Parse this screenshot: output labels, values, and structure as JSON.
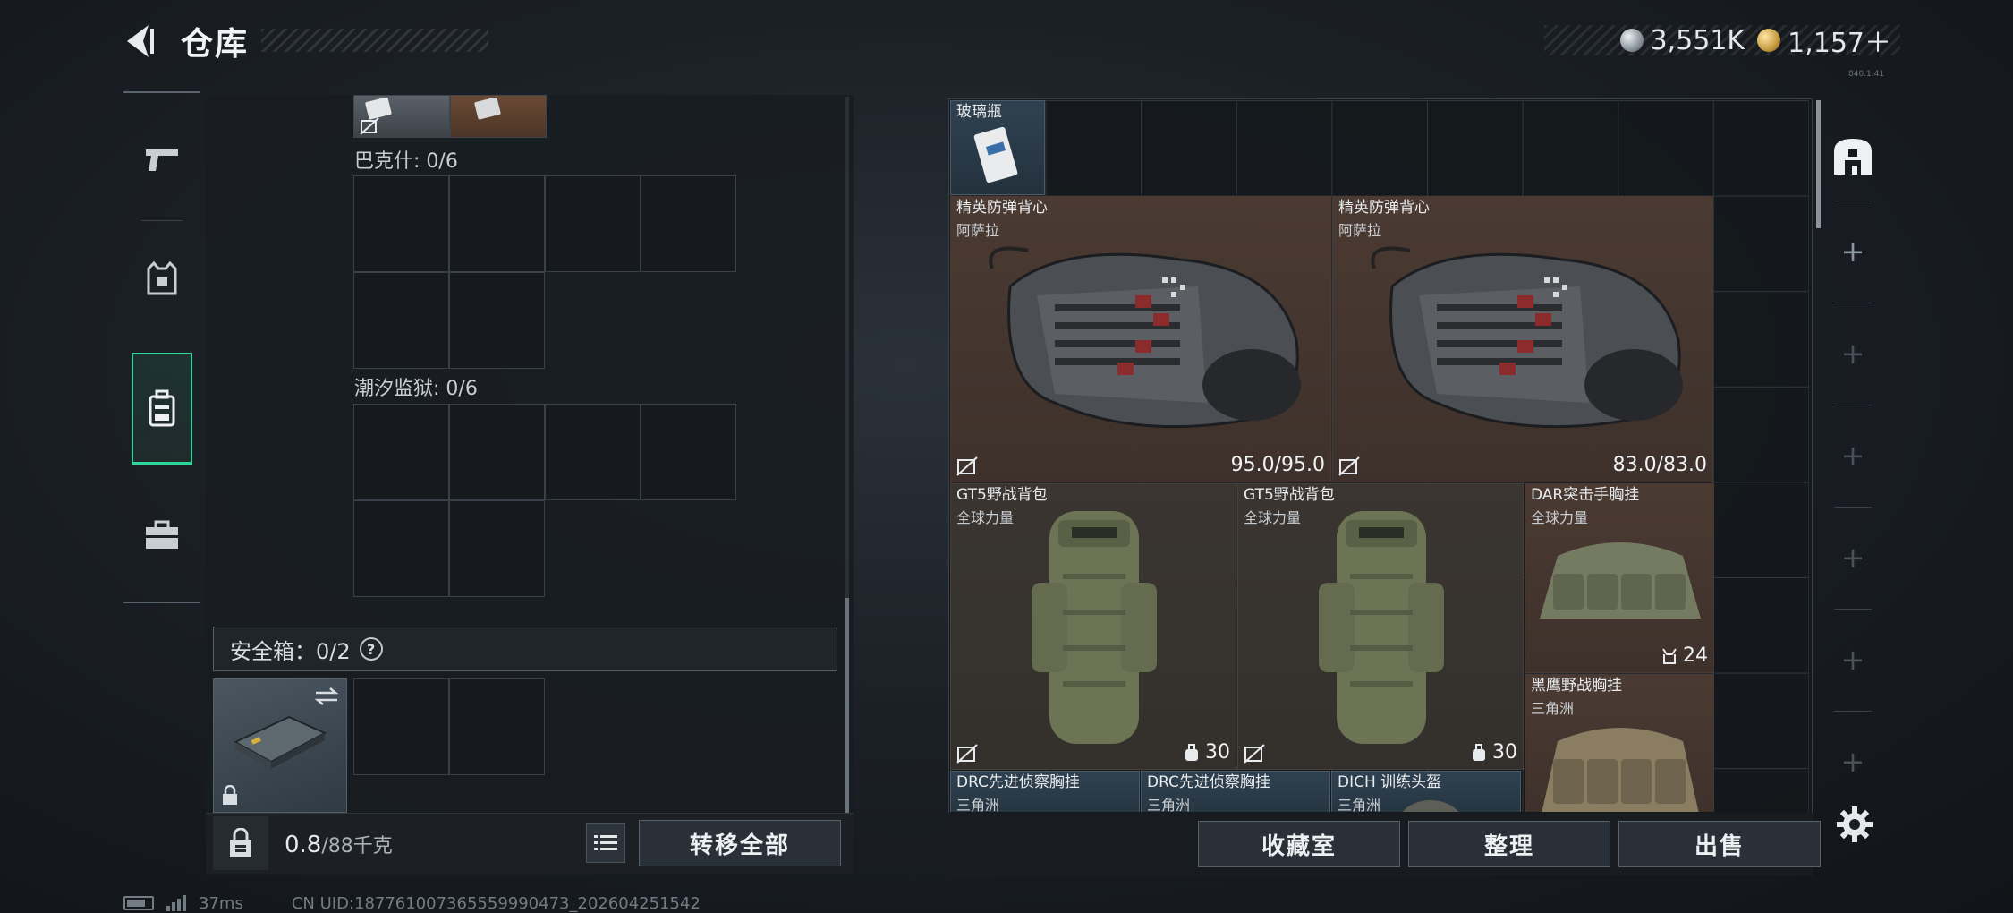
{
  "header": {
    "title": "仓库",
    "currency": [
      {
        "icon": "silver-coin-icon",
        "value": "3,551K"
      },
      {
        "icon": "gold-coin-icon",
        "value": "1,157＋"
      }
    ],
    "version": "840.1.41"
  },
  "nav": {
    "items": [
      {
        "icon": "pistol-icon"
      },
      {
        "icon": "armor-vest-icon"
      },
      {
        "icon": "backpack-icon",
        "active": true
      },
      {
        "icon": "briefcase-icon"
      }
    ]
  },
  "backpack": {
    "sections": [
      {
        "label": "巴克什: 0/6"
      },
      {
        "label": "潮汐监狱: 0/6"
      }
    ],
    "safebox": {
      "label": "安全箱：0/2",
      "help": "?"
    },
    "weight": {
      "current": "0.8",
      "max": "/88千克"
    },
    "transfer_all": "转移全部"
  },
  "stash": {
    "items": [
      {
        "name": "玻璃瓶",
        "brand": ""
      },
      {
        "name": "精英防弹背心",
        "brand": "阿萨拉",
        "stat": "95.0/95.0"
      },
      {
        "name": "精英防弹背心",
        "brand": "阿萨拉",
        "stat": "83.0/83.0"
      },
      {
        "name": "GT5野战背包",
        "brand": "全球力量",
        "stat": "30"
      },
      {
        "name": "GT5野战背包",
        "brand": "全球力量",
        "stat": "30"
      },
      {
        "name": "DAR突击手胸挂",
        "brand": "全球力量",
        "stat": "24"
      },
      {
        "name": "黑鹰野战胸挂",
        "brand": "三角洲"
      },
      {
        "name": "DRC先进侦察胸挂",
        "brand": "三角洲"
      },
      {
        "name": "DRC先进侦察胸挂",
        "brand": "三角洲"
      },
      {
        "name": "DICH 训练头盔",
        "brand": "三角洲"
      }
    ],
    "buttons": {
      "collection": "收藏室",
      "organize": "整理",
      "sell": "出售"
    }
  },
  "status": {
    "ping": "37ms",
    "uid": "CN UID:18776100736555999047​3_202604251542"
  }
}
